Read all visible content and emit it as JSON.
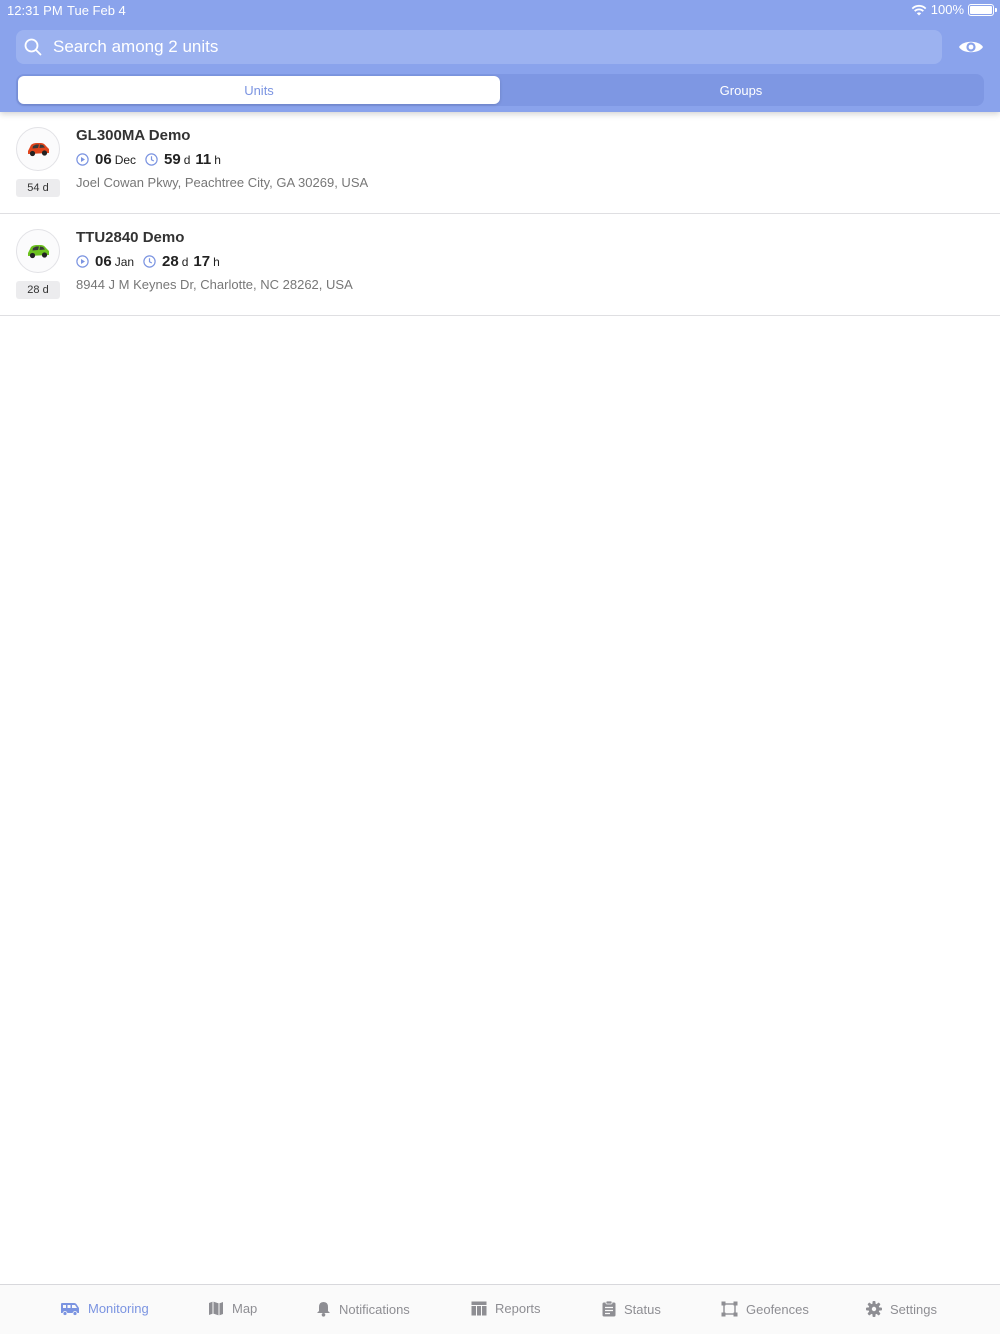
{
  "status_bar": {
    "time": "12:31 PM",
    "date": "Tue Feb 4",
    "battery": "100%"
  },
  "search": {
    "placeholder": "Search among 2 units"
  },
  "segments": [
    {
      "label": "Units",
      "active": true
    },
    {
      "label": "Groups",
      "active": false
    }
  ],
  "units": [
    {
      "name": "GL300MA Demo",
      "age": "54 d",
      "date_day": "06",
      "date_month": "Dec",
      "dur_days": "59",
      "dur_days_unit": "d",
      "dur_hours": "11",
      "dur_hours_unit": "h",
      "address": "Joel Cowan Pkwy, Peachtree City, GA 30269, USA",
      "car_color": "#e0451c"
    },
    {
      "name": "TTU2840 Demo",
      "age": "28 d",
      "date_day": "06",
      "date_month": "Jan",
      "dur_days": "28",
      "dur_days_unit": "d",
      "dur_hours": "17",
      "dur_hours_unit": "h",
      "address": "8944 J M Keynes Dr, Charlotte, NC 28262, USA",
      "car_color": "#6cc21f"
    }
  ],
  "tabs": [
    {
      "label": "Monitoring",
      "icon": "bus-icon",
      "active": true
    },
    {
      "label": "Map",
      "icon": "map-icon",
      "active": false
    },
    {
      "label": "Notifications",
      "icon": "bell-icon",
      "active": false
    },
    {
      "label": "Reports",
      "icon": "table-icon",
      "active": false
    },
    {
      "label": "Status",
      "icon": "clipboard-icon",
      "active": false
    },
    {
      "label": "Geofences",
      "icon": "polygon-icon",
      "active": false
    },
    {
      "label": "Settings",
      "icon": "gear-icon",
      "active": false
    }
  ],
  "colors": {
    "header": "#8aa3ec",
    "accent": "#7b94e1"
  }
}
